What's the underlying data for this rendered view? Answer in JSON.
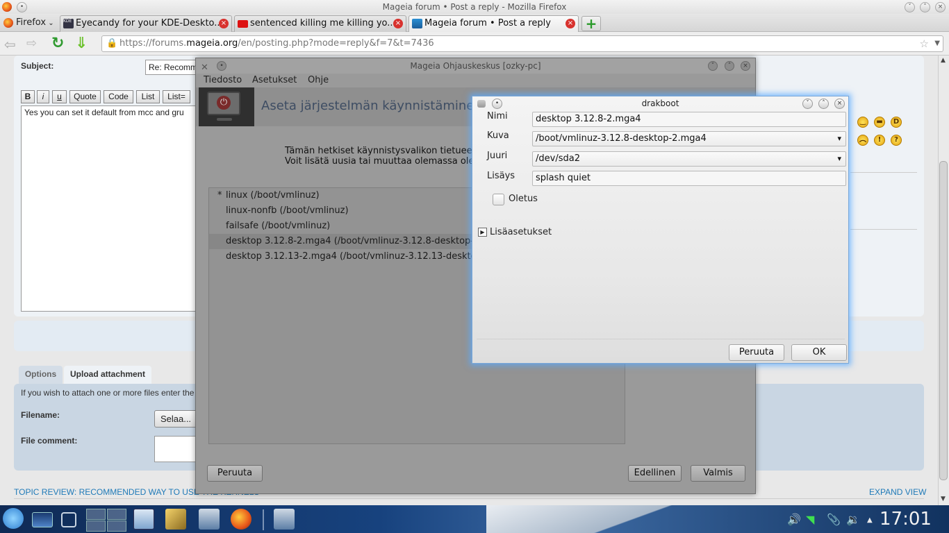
{
  "browser": {
    "window_title": "Mageia forum • Post a reply - Mozilla Firefox",
    "menu_button": "Firefox",
    "tabs": [
      {
        "label": "Eyecandy for your KDE-Deskto..."
      },
      {
        "label": "sentenced killing me killing yo..."
      },
      {
        "label": "Mageia forum • Post a reply"
      }
    ],
    "url_prefix": "https://forums.",
    "url_domain": "mageia.org",
    "url_path": "/en/posting.php?mode=reply&f=7&t=7436"
  },
  "forum": {
    "subject_label": "Subject:",
    "subject_value": "Re: Recomm",
    "format_buttons": [
      "B",
      "i",
      "u",
      "Quote",
      "Code",
      "List",
      "List="
    ],
    "message_text": "Yes you can set it default from mcc and gru",
    "tabs": [
      "Options",
      "Upload attachment"
    ],
    "attach_hint": "If you wish to attach one or more files enter the",
    "filename_label": "Filename:",
    "browse_button": "Selaa...",
    "file_comment_label": "File comment:",
    "topic_review": "TOPIC REVIEW: RECOMMENDED WAY TO USE ",
    "topic_review_hidden": "THE KERNELS",
    "expand_view": "EXPAND VIEW"
  },
  "mcc": {
    "title": "Mageia  Ohjauskeskus [ozky-pc]",
    "menu": [
      "Tiedosto",
      "Asetukset",
      "Ohje"
    ],
    "heading": "Aseta järjestelmän käynnistäminen",
    "info_line1": "Tämän hetkiset käynnistysvalikon tietueet.",
    "info_line2": "Voit lisätä uusia tai muuttaa olemassa olev",
    "entries": [
      {
        "label": "linux (/boot/vmlinuz)",
        "default_mark": "*"
      },
      {
        "label": "linux-nonfb (/boot/vmlinuz)",
        "default_mark": ""
      },
      {
        "label": "failsafe (/boot/vmlinuz)",
        "default_mark": ""
      },
      {
        "label": "desktop 3.12.8-2.mga4 (/boot/vmlinuz-3.12.8-desktop-2.m",
        "default_mark": ""
      },
      {
        "label": "desktop 3.12.13-2.mga4 (/boot/vmlinuz-3.12.13-desktop-",
        "default_mark": ""
      }
    ],
    "selected_entry": 3,
    "cancel_button": "Peruuta",
    "previous_button": "Edellinen",
    "done_button": "Valmis"
  },
  "drakboot": {
    "title": "drakboot",
    "name_label": "Nimi",
    "name_value": "desktop 3.12.8-2.mga4",
    "image_label": "Kuva",
    "image_value": "/boot/vmlinuz-3.12.8-desktop-2.mga4",
    "root_label": "Juuri",
    "root_value": "/dev/sda2",
    "append_label": "Lisäys",
    "append_value": "splash quiet",
    "default_label": "Oletus",
    "default_checked": false,
    "advanced_label": "Lisäasetukset",
    "cancel_button": "Peruuta",
    "ok_button": "OK"
  },
  "taskbar": {
    "clock": "17:01"
  },
  "colors": {
    "accent": "#1f7ab8",
    "dialog_glow": "#5aaaff",
    "mcc_heading": "#3e4d63"
  }
}
